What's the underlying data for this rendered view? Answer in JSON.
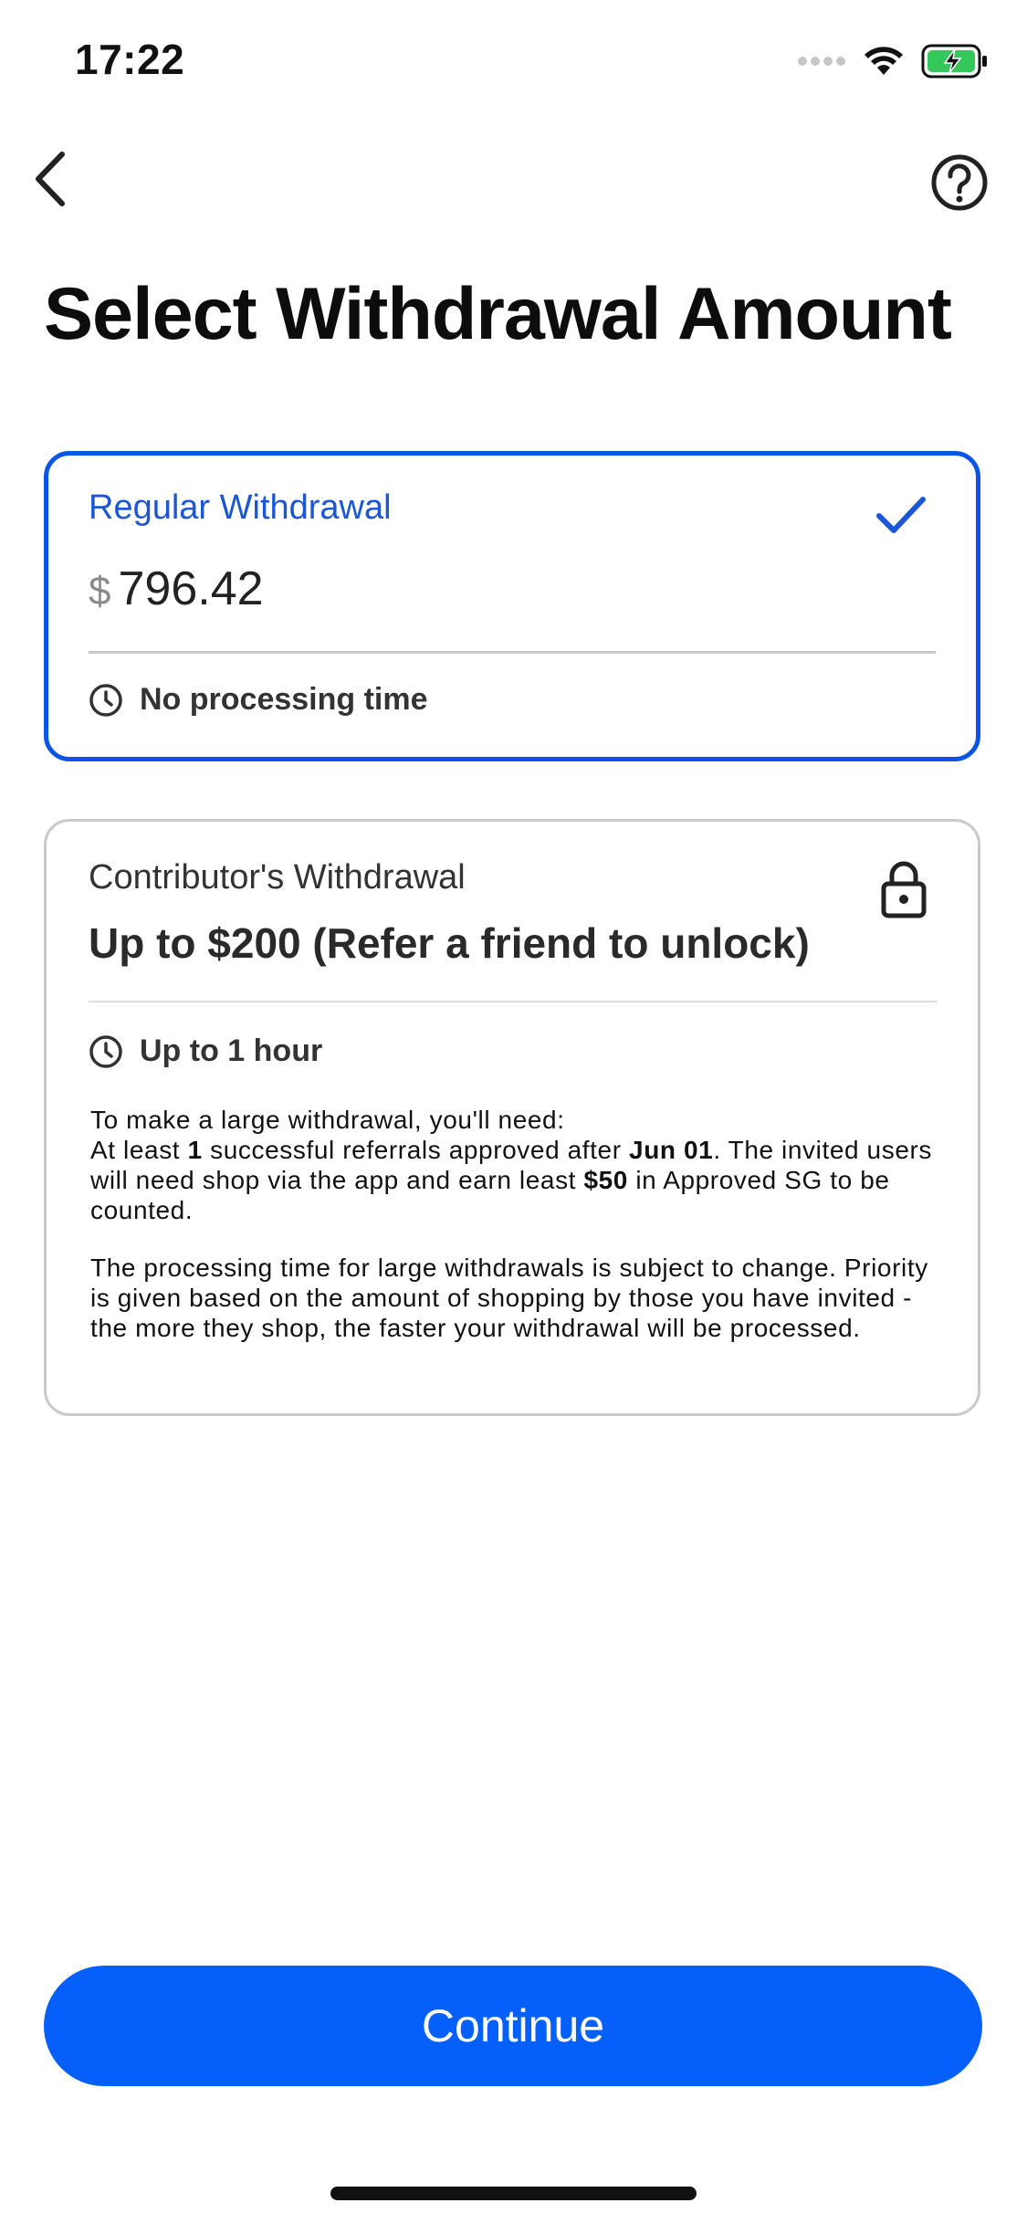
{
  "status_bar": {
    "time": "17:22"
  },
  "nav": {
    "back_icon": "chevron-left-icon",
    "help_icon": "question-circle-icon"
  },
  "page_title": "Select Withdrawal Amount",
  "regular_option": {
    "title": "Regular Withdrawal",
    "currency_symbol": "$",
    "amount": "796.42",
    "processing_time": "No processing time",
    "selected": true
  },
  "contributor_option": {
    "title": "Contributor's Withdrawal",
    "subtitle": "Up to $200 (Refer a friend to unlock)",
    "processing_time": "Up to 1 hour",
    "locked": true,
    "info": {
      "line1": "To make a large withdrawal, you'll need:",
      "req_prefix": "At least ",
      "req_count": "1",
      "req_mid": " successful referrals approved after ",
      "req_date": "Jun 01",
      "req_mid2": ". The invited users will need shop via the app and earn least ",
      "req_amount": "$50",
      "req_suffix": " in Approved SG to be counted.",
      "paragraph2": "The processing time for large withdrawals is subject to change. Priority is given based on the amount of shopping by those you have invited - the more they shop, the faster your withdrawal will be processed."
    }
  },
  "continue_label": "Continue",
  "colors": {
    "accent": "#0560fb",
    "selected_border": "#0a55e5",
    "battery": "#34c759"
  }
}
